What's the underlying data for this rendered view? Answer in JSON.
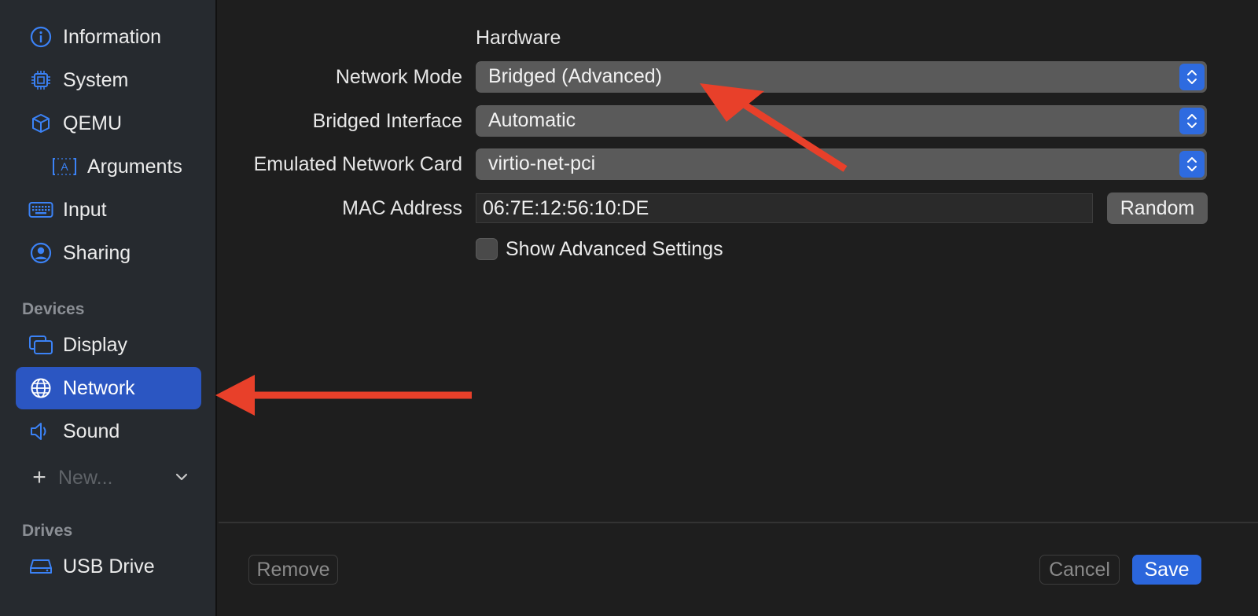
{
  "sidebar": {
    "items": [
      {
        "label": "Information",
        "icon": "info-circle-icon"
      },
      {
        "label": "System",
        "icon": "cpu-chip-icon"
      },
      {
        "label": "QEMU",
        "icon": "cube-icon"
      },
      {
        "label": "Arguments",
        "icon": "text-box-icon"
      },
      {
        "label": "Input",
        "icon": "keyboard-icon"
      },
      {
        "label": "Sharing",
        "icon": "person-circle-icon"
      }
    ],
    "devices_heading": "Devices",
    "devices": [
      {
        "label": "Display",
        "icon": "display-windows-icon"
      },
      {
        "label": "Network",
        "icon": "globe-icon",
        "selected": true
      },
      {
        "label": "Sound",
        "icon": "speaker-icon"
      }
    ],
    "new_label": "New...",
    "drives_heading": "Drives",
    "drives": [
      {
        "label": "USB Drive",
        "icon": "drive-icon"
      }
    ]
  },
  "main": {
    "section_title": "Hardware",
    "network_mode_label": "Network Mode",
    "network_mode_value": "Bridged (Advanced)",
    "bridged_interface_label": "Bridged Interface",
    "bridged_interface_value": "Automatic",
    "network_card_label": "Emulated Network Card",
    "network_card_value": "virtio-net-pci",
    "mac_label": "MAC Address",
    "mac_value": "06:7E:12:56:10:DE",
    "random_label": "Random",
    "advanced_label": "Show Advanced Settings",
    "advanced_checked": false
  },
  "footer": {
    "remove_label": "Remove",
    "cancel_label": "Cancel",
    "save_label": "Save"
  },
  "colors": {
    "accent": "#2b56c2",
    "annotation_arrow": "#e8402a"
  }
}
